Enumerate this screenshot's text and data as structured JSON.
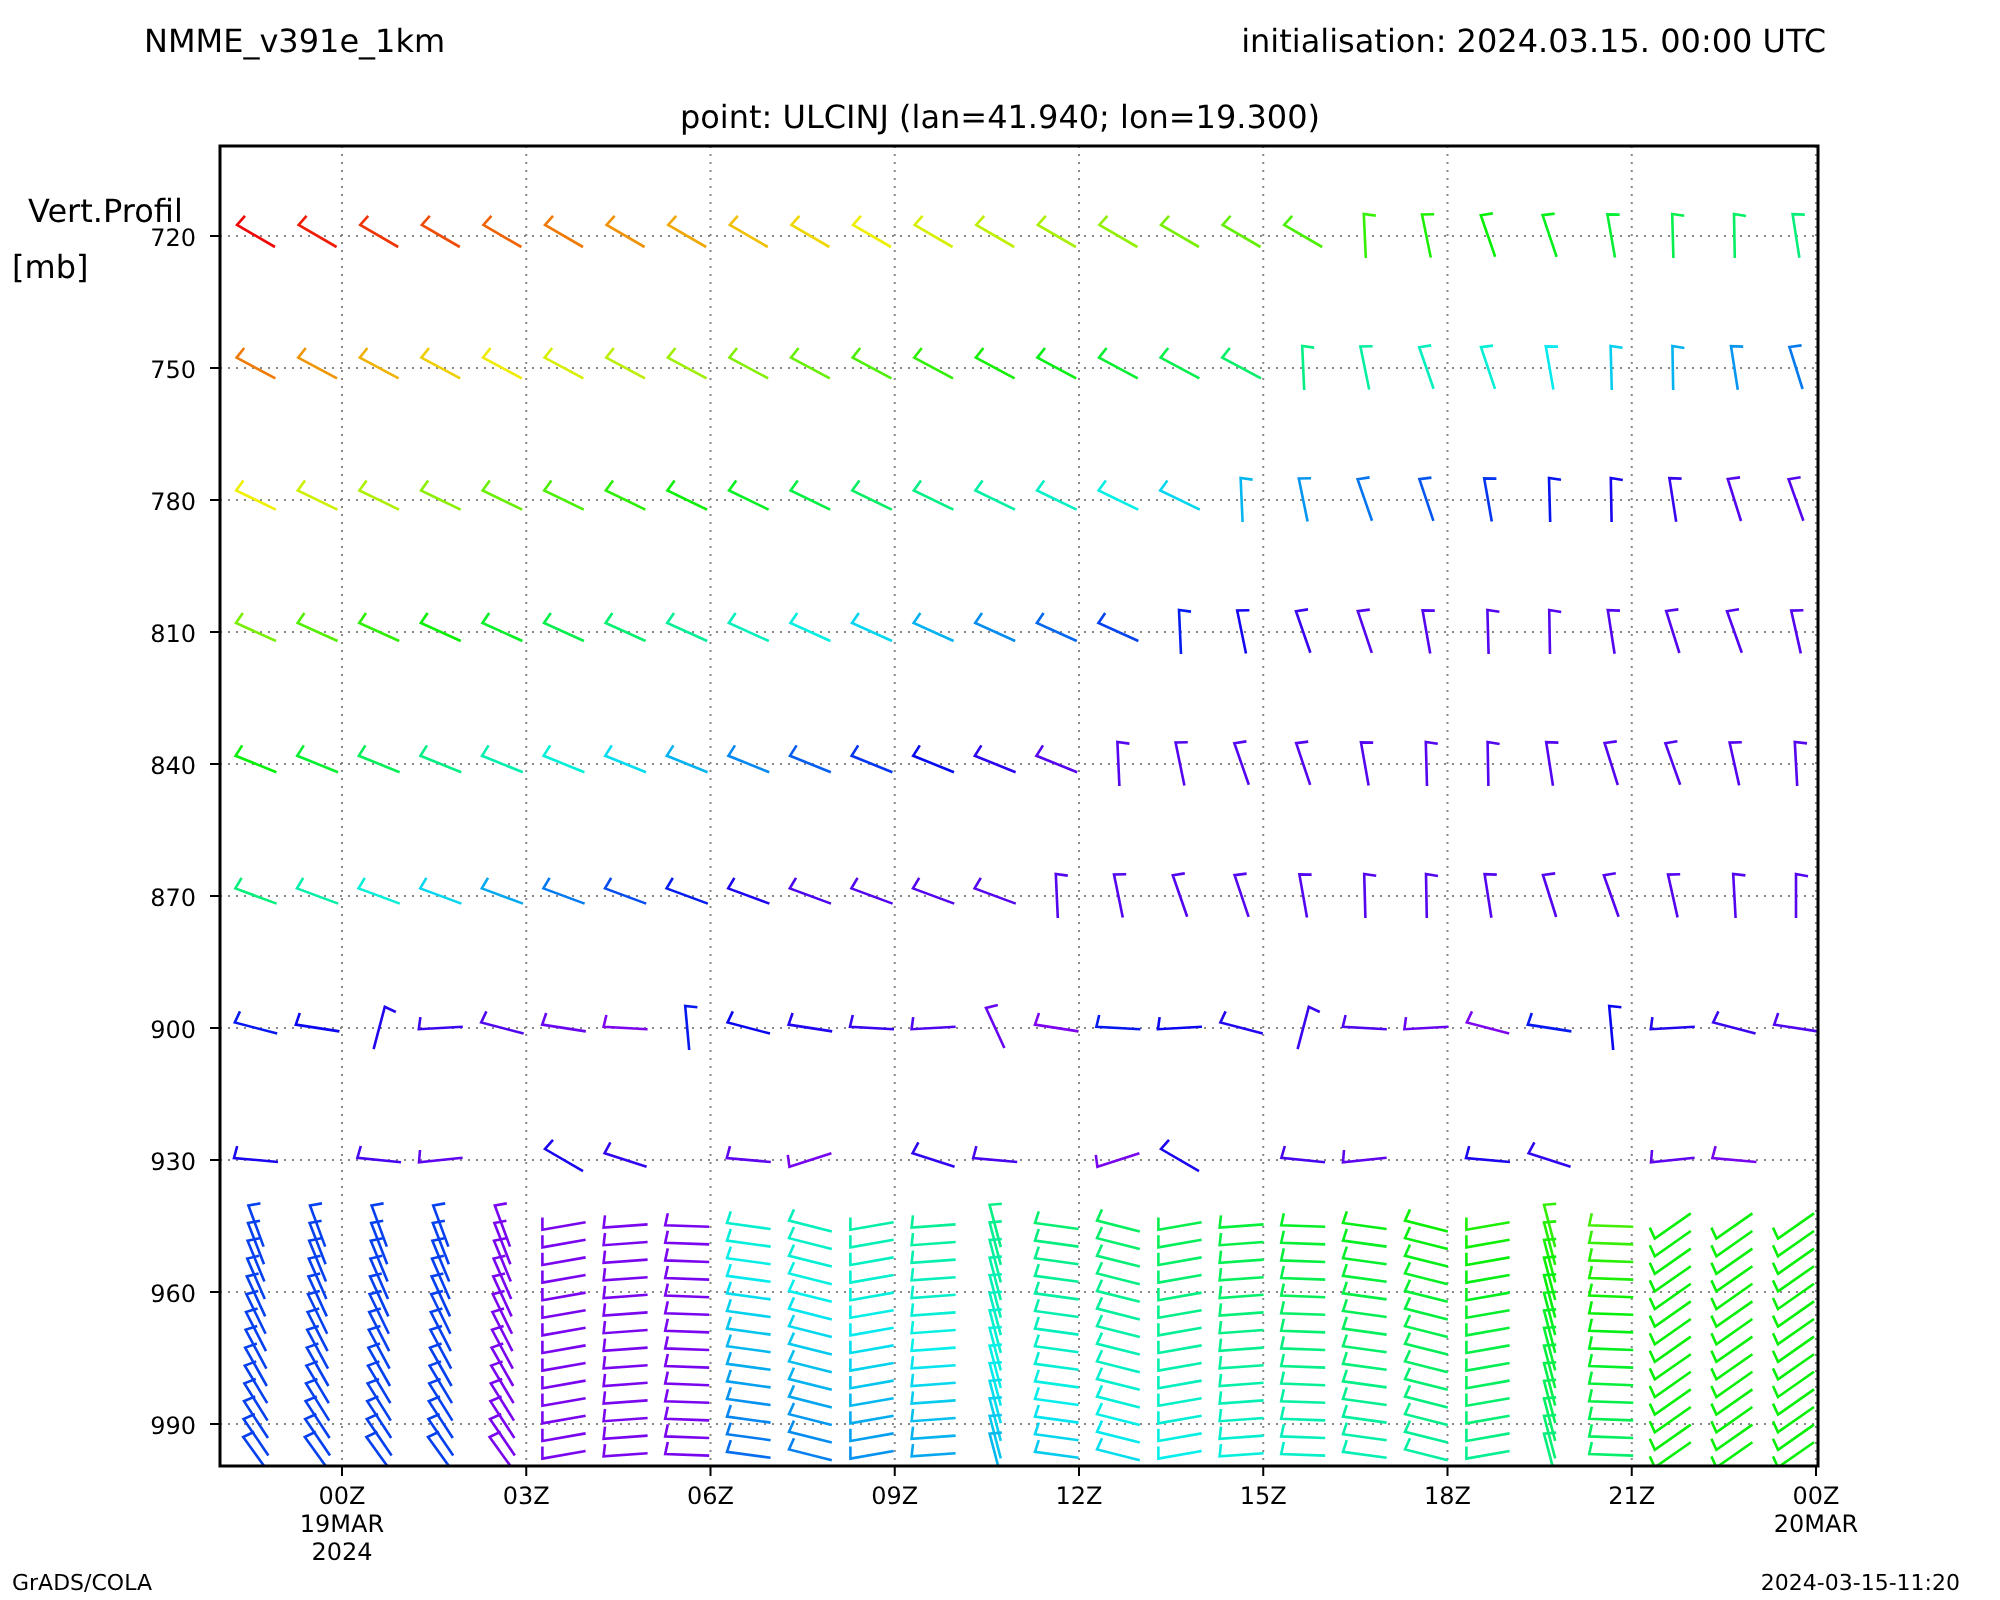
{
  "header": {
    "model": "NMME_v391e_1km",
    "initialisation": "initialisation: 2024.03.15. 00:00 UTC",
    "point": "point: ULCINJ (lan=41.940; lon=19.300)"
  },
  "chart": {
    "ylabel": [
      "Vert.Profil",
      "[mb]"
    ],
    "yticks": [
      "720",
      "750",
      "780",
      "810",
      "840",
      "870",
      "900",
      "930",
      "960",
      "990"
    ],
    "xticks": [
      {
        "label": "00Z",
        "sub": [
          "19MAR",
          "2024"
        ]
      },
      {
        "label": "03Z"
      },
      {
        "label": "06Z"
      },
      {
        "label": "09Z"
      },
      {
        "label": "12Z"
      },
      {
        "label": "15Z"
      },
      {
        "label": "18Z"
      },
      {
        "label": "21Z"
      },
      {
        "label": "00Z",
        "sub": [
          "20MAR"
        ]
      }
    ]
  },
  "footer": {
    "left": "GrADS/COLA",
    "right": "2024-03-15-11:20"
  }
}
